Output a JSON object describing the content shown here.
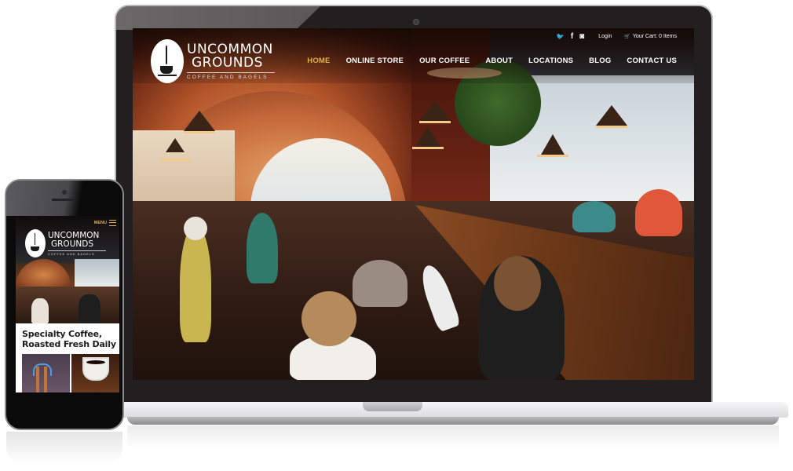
{
  "site": {
    "logo": {
      "line1": "UNCOMMON",
      "line2": "GROUNDS",
      "tagline": "COFFEE AND BAGELS"
    },
    "topbar": {
      "social": [
        {
          "name": "twitter",
          "glyph": "🐦"
        },
        {
          "name": "facebook",
          "glyph": "f"
        },
        {
          "name": "instagram",
          "glyph": "◙"
        }
      ],
      "login_label": "Login",
      "cart_label": "Your Cart: 0 Items",
      "cart_icon": "🛒"
    },
    "nav": {
      "items": [
        {
          "label": "HOME",
          "active": true
        },
        {
          "label": "ONLINE STORE",
          "active": false
        },
        {
          "label": "OUR COFFEE",
          "active": false
        },
        {
          "label": "ABOUT",
          "active": false
        },
        {
          "label": "LOCATIONS",
          "active": false
        },
        {
          "label": "BLOG",
          "active": false
        },
        {
          "label": "CONTACT US",
          "active": false
        }
      ],
      "active_color": "#e3b24f"
    },
    "hero": {
      "image_alt": "Busy coffee shop interior with customers"
    }
  },
  "mobile": {
    "menu_label": "MENU",
    "headline_line1": "Specialty Coffee,",
    "headline_line2": "Roasted Fresh Daily",
    "thumbs": [
      {
        "alt": "Espresso machine pouring"
      },
      {
        "alt": "Cup of coffee with pastry"
      }
    ]
  }
}
